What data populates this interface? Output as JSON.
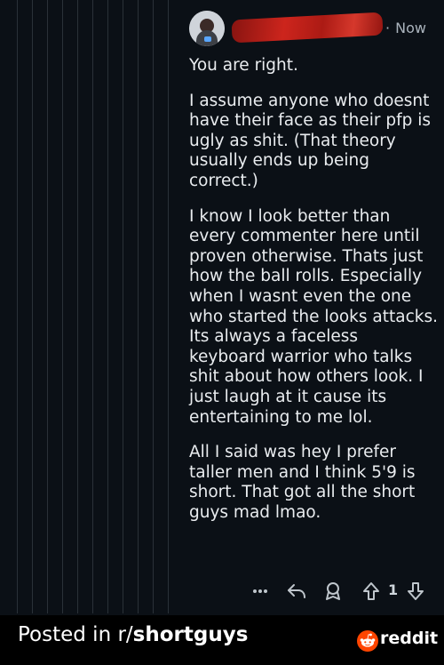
{
  "comment": {
    "time_label": "Now",
    "separator": "·",
    "paragraphs": [
      "You are right.",
      "I assume anyone who doesnt have their face as their pfp is ugly as shit. (That theory usually ends up being correct.)",
      "I know I look better than every commenter here until proven otherwise. Thats just how the ball rolls. Especially when I wasnt even the one who started the looks attacks. Its always a faceless keyboard warrior who talks shit about how others look. I just laugh at it cause its entertaining to me lol.",
      "All I said was hey I prefer taller men and I think 5'9 is short. That got all the short guys mad lmao."
    ],
    "vote_count": "1",
    "actions": {
      "more_icon": "more-horizontal-icon",
      "reply_icon": "reply-arrow-icon",
      "award_icon": "award-icon",
      "upvote_icon": "upvote-arrow-icon",
      "downvote_icon": "downvote-arrow-icon"
    }
  },
  "footer": {
    "posted_prefix": "Posted in r/",
    "subreddit": "shortguys",
    "brand": "reddit",
    "brand_icon": "reddit-snoo-icon"
  },
  "colors": {
    "background": "#0b1016",
    "text": "#e9ecef",
    "muted": "#aab3bc",
    "footer_bg": "#000000",
    "reddit_orange": "#ff4500"
  }
}
